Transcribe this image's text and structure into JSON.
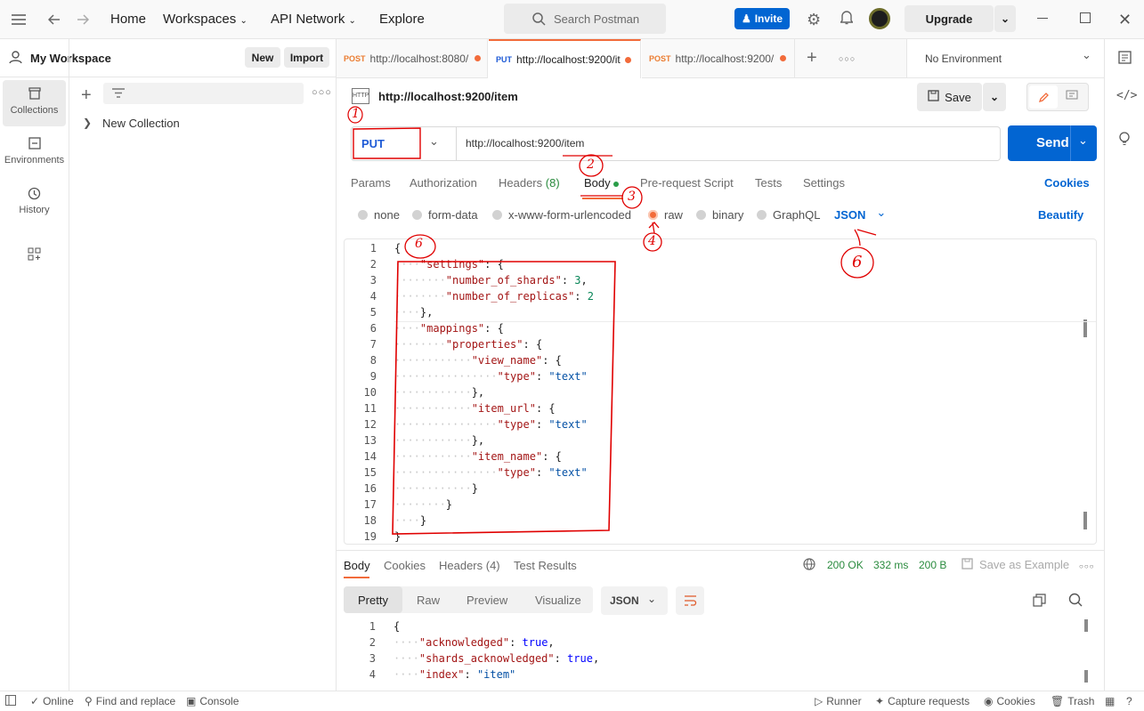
{
  "topbar": {
    "home": "Home",
    "workspaces": "Workspaces",
    "api_network": "API Network",
    "explore": "Explore",
    "search_placeholder": "Search Postman",
    "invite": "Invite",
    "upgrade": "Upgrade"
  },
  "sidebar": {
    "workspace_name": "My Workspace",
    "new_label": "New",
    "import_label": "Import",
    "rail": [
      "Collections",
      "Environments",
      "History"
    ],
    "collection": "New Collection"
  },
  "tabs": [
    {
      "method": "POST",
      "url": "http://localhost:8080/"
    },
    {
      "method": "PUT",
      "url": "http://localhost:9200/it"
    },
    {
      "method": "POST",
      "url": "http://localhost:9200/"
    }
  ],
  "environment": "No Environment",
  "request": {
    "title": "http://localhost:9200/item",
    "save": "Save",
    "method": "PUT",
    "url": "http://localhost:9200/item",
    "send": "Send",
    "subtabs": {
      "params": "Params",
      "authorization": "Authorization",
      "headers": "Headers",
      "headers_count": "(8)",
      "body": "Body",
      "prerequest": "Pre-request Script",
      "tests": "Tests",
      "settings": "Settings",
      "cookies": "Cookies"
    },
    "body_types": [
      "none",
      "form-data",
      "x-www-form-urlencoded",
      "raw",
      "binary",
      "GraphQL"
    ],
    "format": "JSON",
    "beautify": "Beautify"
  },
  "editor_lines": [
    [
      [
        "p",
        "{"
      ]
    ],
    [
      [
        "p",
        "····"
      ],
      [
        "k",
        "\"settings\""
      ],
      [
        "p",
        ": {"
      ]
    ],
    [
      [
        "p",
        "········"
      ],
      [
        "k",
        "\"number_of_shards\""
      ],
      [
        "p",
        ": "
      ],
      [
        "n",
        "3"
      ],
      [
        "p",
        ","
      ]
    ],
    [
      [
        "p",
        "········"
      ],
      [
        "k",
        "\"number_of_replicas\""
      ],
      [
        "p",
        ": "
      ],
      [
        "n",
        "2"
      ]
    ],
    [
      [
        "p",
        "····},"
      ]
    ],
    [
      [
        "p",
        "····"
      ],
      [
        "k",
        "\"mappings\""
      ],
      [
        "p",
        ": {"
      ]
    ],
    [
      [
        "p",
        "········"
      ],
      [
        "k",
        "\"properties\""
      ],
      [
        "p",
        ": {"
      ]
    ],
    [
      [
        "p",
        "············"
      ],
      [
        "k",
        "\"view_name\""
      ],
      [
        "p",
        ": {"
      ]
    ],
    [
      [
        "p",
        "················"
      ],
      [
        "k",
        "\"type\""
      ],
      [
        "p",
        ": "
      ],
      [
        "s",
        "\"text\""
      ]
    ],
    [
      [
        "p",
        "············},"
      ]
    ],
    [
      [
        "p",
        "············"
      ],
      [
        "k",
        "\"item_url\""
      ],
      [
        "p",
        ": {"
      ]
    ],
    [
      [
        "p",
        "················"
      ],
      [
        "k",
        "\"type\""
      ],
      [
        "p",
        ": "
      ],
      [
        "s",
        "\"text\""
      ]
    ],
    [
      [
        "p",
        "············},"
      ]
    ],
    [
      [
        "p",
        "············"
      ],
      [
        "k",
        "\"item_name\""
      ],
      [
        "p",
        ": {"
      ]
    ],
    [
      [
        "p",
        "················"
      ],
      [
        "k",
        "\"type\""
      ],
      [
        "p",
        ": "
      ],
      [
        "s",
        "\"text\""
      ]
    ],
    [
      [
        "p",
        "············}"
      ]
    ],
    [
      [
        "p",
        "········}"
      ]
    ],
    [
      [
        "p",
        "····}"
      ]
    ],
    [
      [
        "p",
        "}"
      ]
    ]
  ],
  "response": {
    "tabs": {
      "body": "Body",
      "cookies": "Cookies",
      "headers": "Headers (4)",
      "test_results": "Test Results"
    },
    "status": "200 OK",
    "time": "332 ms",
    "size": "200 B",
    "save_example": "Save as Example",
    "views": [
      "Pretty",
      "Raw",
      "Preview",
      "Visualize"
    ],
    "format": "JSON",
    "lines": [
      [
        [
          "p",
          "{"
        ]
      ],
      [
        [
          "p",
          "····"
        ],
        [
          "k",
          "\"acknowledged\""
        ],
        [
          "p",
          ": "
        ],
        [
          "kw",
          "true"
        ],
        [
          "p",
          ","
        ]
      ],
      [
        [
          "p",
          "····"
        ],
        [
          "k",
          "\"shards_acknowledged\""
        ],
        [
          "p",
          ": "
        ],
        [
          "kw",
          "true"
        ],
        [
          "p",
          ","
        ]
      ],
      [
        [
          "p",
          "····"
        ],
        [
          "k",
          "\"index\""
        ],
        [
          "p",
          ": "
        ],
        [
          "s",
          "\"item\""
        ]
      ]
    ]
  },
  "annotations": [
    "1",
    "2",
    "3",
    "4",
    "6",
    "6"
  ],
  "statusbar": {
    "online": "Online",
    "find": "Find and replace",
    "console": "Console",
    "runner": "Runner",
    "capture": "Capture requests",
    "cookies": "Cookies",
    "trash": "Trash"
  }
}
